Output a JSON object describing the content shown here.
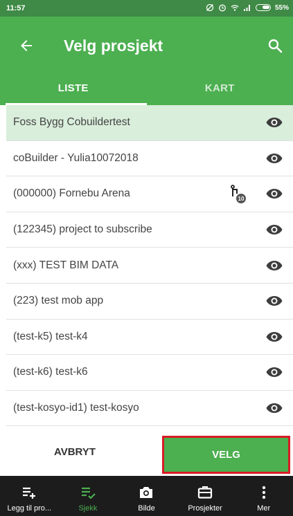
{
  "status_bar": {
    "time": "11:57",
    "battery": "55%"
  },
  "app_bar": {
    "title": "Velg prosjekt",
    "icons": [
      "back-arrow-icon",
      "search-icon"
    ]
  },
  "tabs": [
    {
      "label": "LISTE",
      "active": true
    },
    {
      "label": "KART",
      "active": false
    }
  ],
  "projects": [
    {
      "name": "Foss Bygg Cobuildertest",
      "selected": true
    },
    {
      "name": "coBuilder - Yulia10072018"
    },
    {
      "name": "(000000) Fornebu Arena",
      "branch_badge": "10"
    },
    {
      "name": "(122345) project to subscribe"
    },
    {
      "name": "(xxx) TEST BIM DATA"
    },
    {
      "name": "(223) test mob app"
    },
    {
      "name": "(test-k5) test-k4"
    },
    {
      "name": "(test-k6) test-k6"
    },
    {
      "name": "(test-kosyo-id1) test-kosyo"
    }
  ],
  "actions": {
    "cancel_label": "AVBRYT",
    "choose_label": "VELG"
  },
  "bottom_nav": [
    {
      "label": "Legg til pro...",
      "icon": "playlist-add-icon"
    },
    {
      "label": "Sjekk",
      "icon": "playlist-check-icon",
      "active": true
    },
    {
      "label": "Bilde",
      "icon": "camera-icon"
    },
    {
      "label": "Prosjekter",
      "icon": "briefcase-icon"
    },
    {
      "label": "Mer",
      "icon": "more-vertical-icon"
    }
  ],
  "colors": {
    "primary": "#4caf50",
    "status_bar": "#3f8a46",
    "selected_row": "#d9eedb",
    "highlight_border": "#d81b24",
    "nav_bg": "#1c1c1c"
  }
}
